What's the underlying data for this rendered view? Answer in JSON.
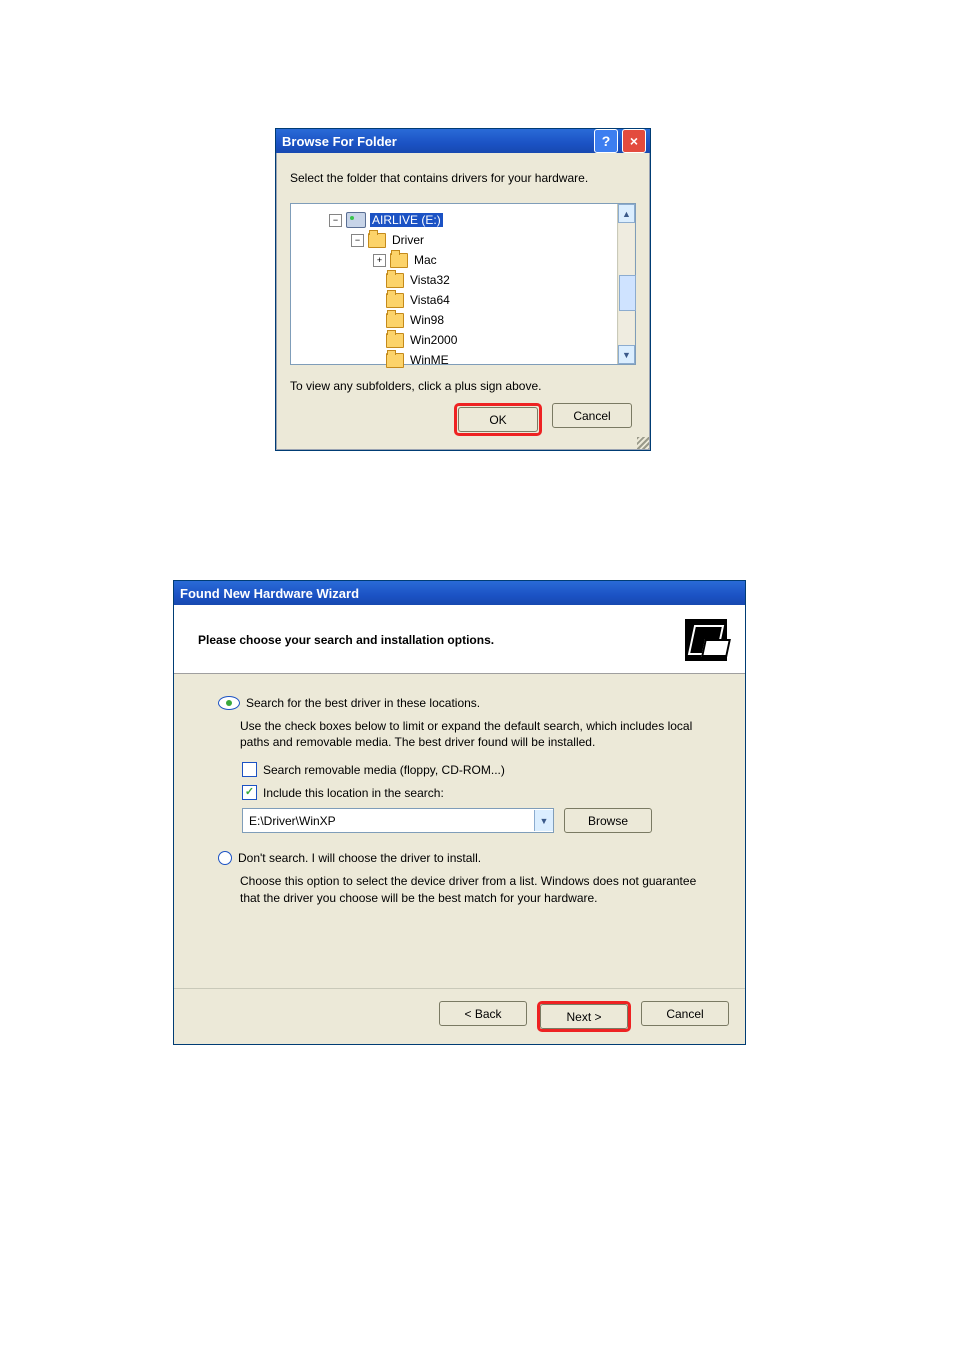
{
  "dialog1": {
    "title": "Browse For Folder",
    "instruction": "Select the folder that contains drivers for your hardware.",
    "tree": {
      "drive": "AIRLIVE (E:)",
      "driver": "Driver",
      "items": [
        "Mac",
        "Vista32",
        "Vista64",
        "Win98",
        "Win2000",
        "WinME"
      ]
    },
    "hint": "To view any subfolders, click a plus sign above.",
    "ok": "OK",
    "cancel": "Cancel"
  },
  "dialog2": {
    "title": "Found New Hardware Wizard",
    "heading": "Please choose your search and installation options.",
    "radio_search": "Search for the best driver in these locations.",
    "search_help": "Use the check boxes below to limit or expand the default search, which includes local paths and removable media. The best driver found will be installed.",
    "cb_removable": "Search removable media (floppy, CD-ROM...)",
    "cb_include": "Include this location in the search:",
    "location_value": "E:\\Driver\\WinXP",
    "browse": "Browse",
    "radio_dont": "Don't search. I will choose the driver to install.",
    "dont_help": "Choose this option to select the device driver from a list.  Windows does not guarantee that the driver you choose will be the best match for your hardware.",
    "back": "< Back",
    "next": "Next >",
    "cancel": "Cancel"
  }
}
